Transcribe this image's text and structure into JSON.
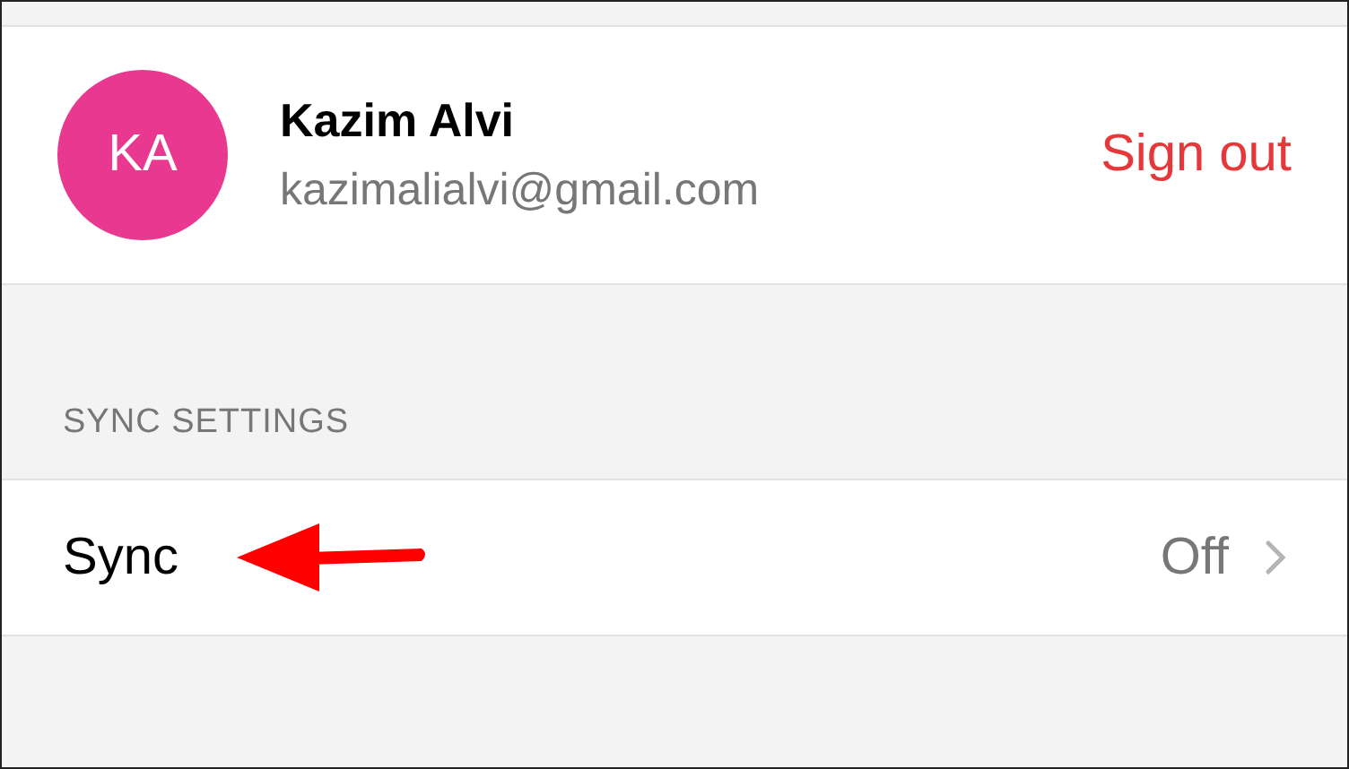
{
  "account": {
    "initials": "KA",
    "name": "Kazim Alvi",
    "email": "kazimalialvi@gmail.com",
    "sign_out": "Sign out"
  },
  "sync_settings": {
    "header": "SYNC SETTINGS",
    "rows": [
      {
        "label": "Sync",
        "value": "Off"
      }
    ]
  }
}
